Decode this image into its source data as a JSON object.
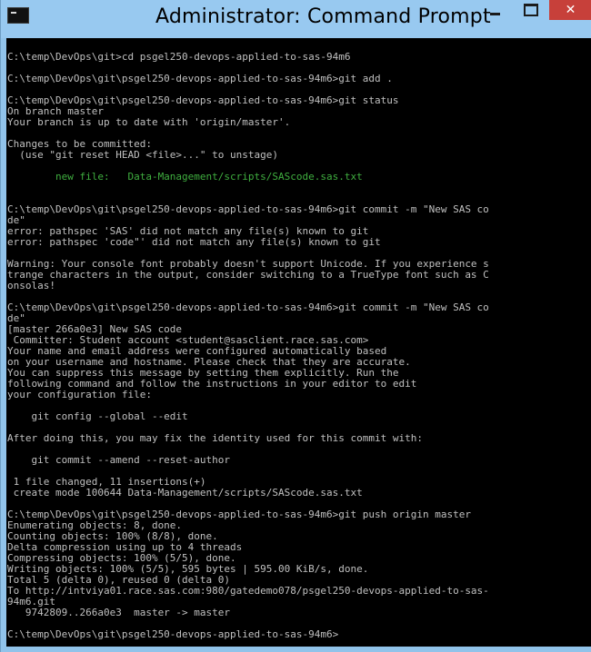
{
  "window": {
    "title": "Administrator: Command Prompt",
    "icon": "cmd-icon",
    "controls": {
      "minimize": "minimize-icon",
      "maximize": "maximize-icon",
      "close": "close-icon"
    }
  },
  "console": {
    "lines": [
      "",
      "C:\\temp\\DevOps\\git>cd psgel250-devops-applied-to-sas-94m6",
      "",
      "C:\\temp\\DevOps\\git\\psgel250-devops-applied-to-sas-94m6>git add .",
      "",
      "C:\\temp\\DevOps\\git\\psgel250-devops-applied-to-sas-94m6>git status",
      "On branch master",
      "Your branch is up to date with 'origin/master'.",
      "",
      "Changes to be committed:",
      "  (use \"git reset HEAD <file>...\" to unstage)",
      "",
      "        new file:   Data-Management/scripts/SAScode.sas.txt",
      "",
      "",
      "C:\\temp\\DevOps\\git\\psgel250-devops-applied-to-sas-94m6>git commit -m \"New SAS co",
      "de\"",
      "error: pathspec 'SAS' did not match any file(s) known to git",
      "error: pathspec 'code\"' did not match any file(s) known to git",
      "",
      "Warning: Your console font probably doesn't support Unicode. If you experience s",
      "trange characters in the output, consider switching to a TrueType font such as C",
      "onsolas!",
      "",
      "C:\\temp\\DevOps\\git\\psgel250-devops-applied-to-sas-94m6>git commit -m \"New SAS co",
      "de\"",
      "[master 266a0e3] New SAS code",
      " Committer: Student account <student@sasclient.race.sas.com>",
      "Your name and email address were configured automatically based",
      "on your username and hostname. Please check that they are accurate.",
      "You can suppress this message by setting them explicitly. Run the",
      "following command and follow the instructions in your editor to edit",
      "your configuration file:",
      "",
      "    git config --global --edit",
      "",
      "After doing this, you may fix the identity used for this commit with:",
      "",
      "    git commit --amend --reset-author",
      "",
      " 1 file changed, 11 insertions(+)",
      " create mode 100644 Data-Management/scripts/SAScode.sas.txt",
      "",
      "C:\\temp\\DevOps\\git\\psgel250-devops-applied-to-sas-94m6>git push origin master",
      "Enumerating objects: 8, done.",
      "Counting objects: 100% (8/8), done.",
      "Delta compression using up to 4 threads",
      "Compressing objects: 100% (5/5), done.",
      "Writing objects: 100% (5/5), 595 bytes | 595.00 KiB/s, done.",
      "Total 5 (delta 0), reused 0 (delta 0)",
      "To http://intviya01.race.sas.com:980/gatedemo078/psgel250-devops-applied-to-sas-",
      "94m6.git",
      "   9742809..266a0e3  master -> master",
      "",
      "C:\\temp\\DevOps\\git\\psgel250-devops-applied-to-sas-94m6>"
    ],
    "highlight_color": "#3fae3f",
    "text_color": "#c0c0c0",
    "background": "#000000"
  }
}
